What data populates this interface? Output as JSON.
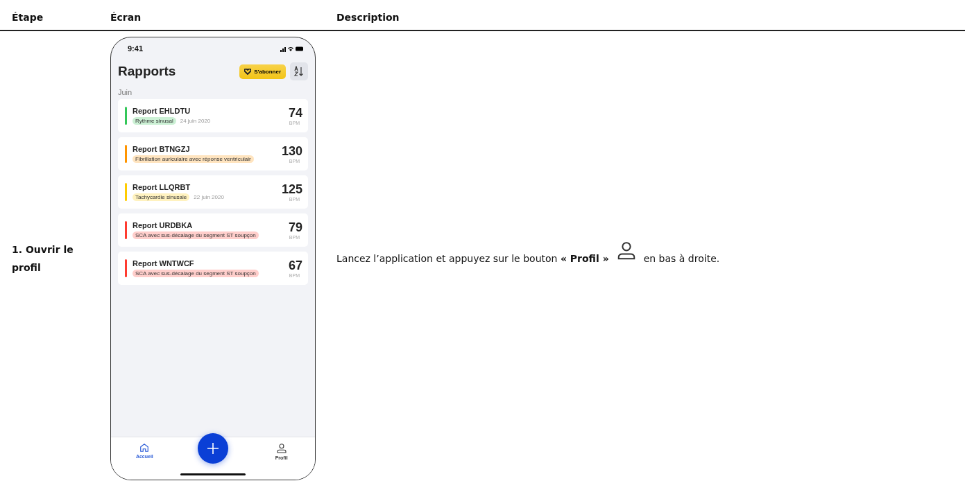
{
  "table": {
    "columns": [
      "Étape",
      "Écran",
      "Description"
    ],
    "rows": [
      {
        "step": "1. Ouvrir le profil",
        "phone": {
          "status_time": "9:41",
          "title": "Rapports",
          "subscribe_button": "S'abonner",
          "section": "Juin",
          "reports": [
            {
              "name": "Report EHLDTU",
              "tag": "Rythme sinusal",
              "date": "24 juin 2020",
              "bpm": "74",
              "unit": "BPM",
              "color": "#34c759"
            },
            {
              "name": "Report BTNGZJ",
              "tag": "Fibrillation auriculaire avec réponse ventriculair",
              "bpm": "130",
              "unit": "BPM",
              "color": "#ff9500"
            },
            {
              "name": "Report LLQRBT",
              "tag": "Tachycardie sinusale",
              "date": "22 juin 2020",
              "bpm": "125",
              "unit": "BPM",
              "color": "#ffcc00"
            },
            {
              "name": "Report URDBKA",
              "tag": "SCA avec sus-décalage du segment ST soupçon",
              "bpm": "79",
              "unit": "BPM",
              "color": "#ff3b30"
            },
            {
              "name": "Report WNTWCF",
              "tag": "SCA avec sus-décalage du segment ST soupçon",
              "bpm": "67",
              "unit": "BPM",
              "color": "#ff3b30"
            }
          ],
          "nav": [
            {
              "label": "Accueil",
              "kind": "home",
              "selected": true
            },
            {
              "label": "Profil",
              "kind": "profile",
              "selected": false
            }
          ]
        },
        "description": {
          "before": "Lancez l’application et appuyez sur le bouton **« Profil »**",
          "after": "en bas à droite."
        }
      }
    ]
  }
}
